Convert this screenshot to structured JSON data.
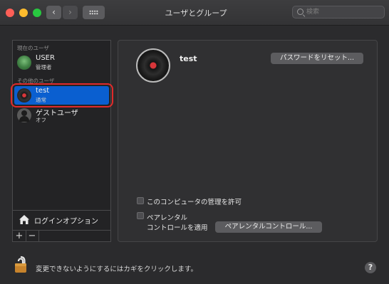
{
  "window": {
    "title": "ユーザとグループ",
    "search_placeholder": "検索",
    "nav_back": "‹",
    "nav_forward": "›"
  },
  "sidebar": {
    "current_user_header": "現在のユーザ",
    "current_user": {
      "name": "USER",
      "role": "管理者",
      "icon": "user-avatar-icon"
    },
    "other_users_header": "その他のユーザ",
    "other_users": [
      {
        "name": "test",
        "role": "通常",
        "icon": "record-avatar-icon",
        "selected": true
      },
      {
        "name": "ゲストユーザ",
        "role": "オフ",
        "icon": "guest-user-icon",
        "selected": false
      }
    ],
    "login_options": "ログインオプション",
    "add_label": "+",
    "remove_label": "−"
  },
  "detail": {
    "username": "test",
    "reset_password_button": "パスワードをリセット...",
    "allow_admin_label": "このコンピュータの管理を許可",
    "parental_label_line1": "ペアレンタル",
    "parental_label_line2": "コントロールを適用",
    "parental_controls_button": "ペアレンタルコントロール..."
  },
  "footer": {
    "lock_text": "変更できないようにするにはカギをクリックします。",
    "help_label": "?"
  },
  "colors": {
    "selection": "#0a5fd0",
    "highlight_ring": "#e02a2a"
  }
}
